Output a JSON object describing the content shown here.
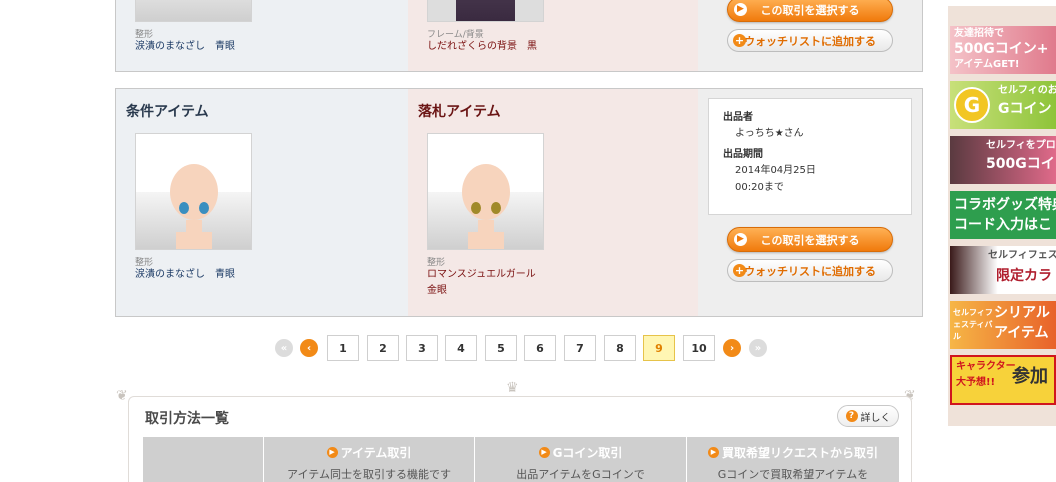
{
  "top_row": {
    "cond_item": {
      "category": "整形",
      "name": "涙潰のまなざし　青眼"
    },
    "bid_item": {
      "category": "フレーム/背景",
      "name": "しだれざくらの背景　黒"
    },
    "select_button": "この取引を選択する",
    "watch_button": "ウォッチリストに追加する"
  },
  "row2": {
    "cond_title": "条件アイテム",
    "bid_title": "落札アイテム",
    "cond_item": {
      "category": "整形",
      "name": "涙潰のまなざし　青眼"
    },
    "bid_item": {
      "category": "整形",
      "name_line1": "ロマンスジュエルガール",
      "name_line2": "金眼"
    },
    "seller_label": "出品者",
    "seller": "よっちち★さん",
    "period_label": "出品期間",
    "period_date": "2014年04月25日",
    "period_time": "00:20まで",
    "select_button": "この取引を選択する",
    "watch_button": "ウォッチリストに追加する"
  },
  "pagination": {
    "pages": [
      "1",
      "2",
      "3",
      "4",
      "5",
      "6",
      "7",
      "8",
      "9",
      "10"
    ],
    "current": "9"
  },
  "methods": {
    "title": "取引方法一覧",
    "detail_button": "詳しく",
    "columns": [
      {
        "head": "",
        "desc": ""
      },
      {
        "head": "アイテム取引",
        "desc": "アイテム同士を取引する機能です"
      },
      {
        "head": "Gコイン取引",
        "desc": "出品アイテムをGコインで"
      },
      {
        "head": "買取希望リクエストから取引",
        "desc": "Gコインで買取希望アイテムを"
      }
    ]
  },
  "banners": [
    {
      "line1": "友達招待で",
      "line2": "500Gコイン+",
      "line3": "アイテムGET!",
      "color": "#d97a8a"
    },
    {
      "line1": "セルフィのお",
      "line2": "Gコイン",
      "line3": "",
      "color": "#a5d247"
    },
    {
      "line1": "セルフィをプロ",
      "line2": "500Gコイ",
      "line3": "",
      "color": "#c0486a"
    },
    {
      "line1": "コラボグッズ特典",
      "line2": "コード入力はこ",
      "line3": "",
      "color": "#2e9e4e"
    },
    {
      "line1": "セルフィフェスタ",
      "line2": "限定カラ",
      "line3": "",
      "color": "#b01e2e"
    },
    {
      "line1": "セルフィフェスティバル",
      "line2": "シリアル",
      "line3": "アイテム",
      "color": "#f0a21a"
    },
    {
      "line1": "キャラクター",
      "line2": "大予想!!",
      "line3": "参加",
      "color": "#f5c21a"
    }
  ]
}
